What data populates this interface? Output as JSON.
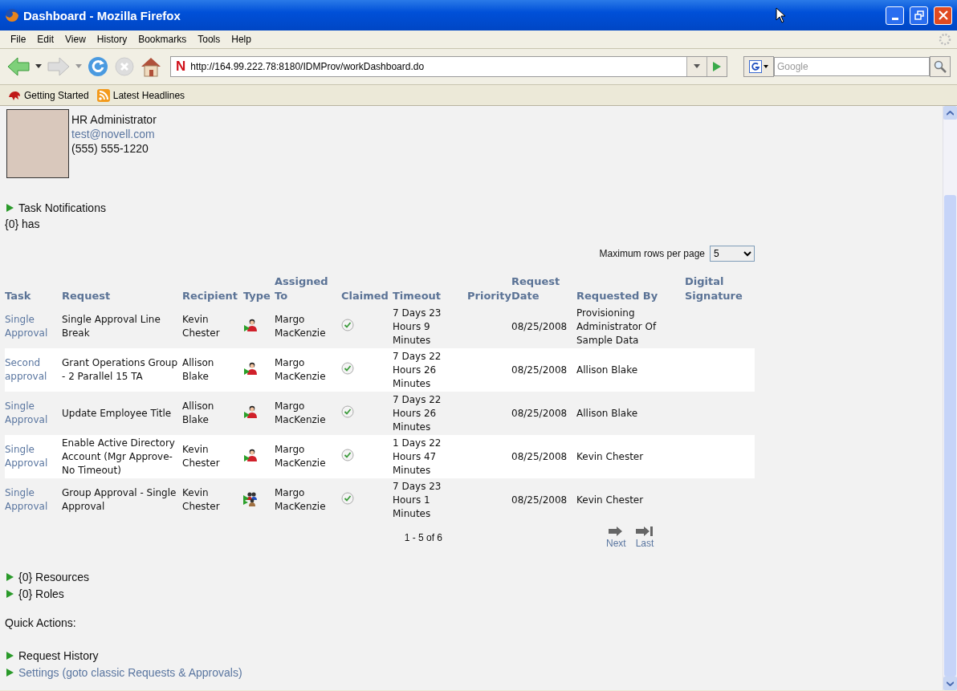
{
  "window": {
    "title": "Dashboard - Mozilla Firefox"
  },
  "menu": [
    "File",
    "Edit",
    "View",
    "History",
    "Bookmarks",
    "Tools",
    "Help"
  ],
  "navigation": {
    "site_icon": "N",
    "url": "http://164.99.222.78:8180/IDMProv/workDashboard.do",
    "search_placeholder": "Google"
  },
  "bookmarks": [
    "Getting Started",
    "Latest Headlines"
  ],
  "profile": {
    "title": "HR Administrator",
    "email": "test@novell.com",
    "phone": "(555) 555-1220"
  },
  "task_notifications": {
    "label": "Task Notifications",
    "message": "{0} has"
  },
  "rows_per_page": {
    "label": "Maximum rows per page",
    "value": "5"
  },
  "table": {
    "columns": [
      "Task",
      "Request",
      "Recipient",
      "Type",
      "Assigned To",
      "Claimed",
      "Timeout",
      "Priority",
      "Request Date",
      "Requested By",
      "Digital Signature"
    ],
    "rows": [
      {
        "task": "Single Approval",
        "request": "Single Approval Line Break",
        "recipient": "Kevin Chester",
        "kind": "user",
        "assigned_to": "Margo MacKenzie",
        "claimed": true,
        "timeout": "7 Days 23 Hours 9 Minutes",
        "request_date": "08/25/2008",
        "requested_by": "Provisioning Administrator Of Sample Data"
      },
      {
        "task": "Second approval",
        "request": "Grant Operations Group - 2 Parallel 15 TA",
        "recipient": "Allison Blake",
        "kind": "user",
        "assigned_to": "Margo MacKenzie",
        "claimed": true,
        "timeout": "7 Days 22 Hours 26 Minutes",
        "request_date": "08/25/2008",
        "requested_by": "Allison Blake"
      },
      {
        "task": "Single Approval",
        "request": "Update Employee Title",
        "recipient": "Allison Blake",
        "kind": "user",
        "assigned_to": "Margo MacKenzie",
        "claimed": true,
        "timeout": "7 Days 22 Hours 26 Minutes",
        "request_date": "08/25/2008",
        "requested_by": "Allison Blake"
      },
      {
        "task": "Single Approval",
        "request": "Enable Active Directory Account (Mgr Approve-No Timeout)",
        "recipient": "Kevin Chester",
        "kind": "user",
        "assigned_to": "Margo MacKenzie",
        "claimed": true,
        "timeout": "1 Days 22 Hours 47 Minutes",
        "request_date": "08/25/2008",
        "requested_by": "Kevin Chester"
      },
      {
        "task": "Single Approval",
        "request": "Group Approval - Single Approval",
        "recipient": "Kevin Chester",
        "kind": "group",
        "assigned_to": "Margo MacKenzie",
        "claimed": true,
        "timeout": "7 Days 23 Hours 1 Minutes",
        "request_date": "08/25/2008",
        "requested_by": "Kevin Chester"
      }
    ]
  },
  "pager": {
    "range": "1 - 5 of 6",
    "next": "Next",
    "last": "Last"
  },
  "sections": [
    "{0} Resources",
    "{0} Roles"
  ],
  "quick_actions": {
    "label": "Quick Actions:",
    "items": [
      {
        "label": "Request History",
        "kind": "text"
      },
      {
        "label": "Settings (goto classic Requests & Approvals)",
        "kind": "link"
      }
    ]
  }
}
